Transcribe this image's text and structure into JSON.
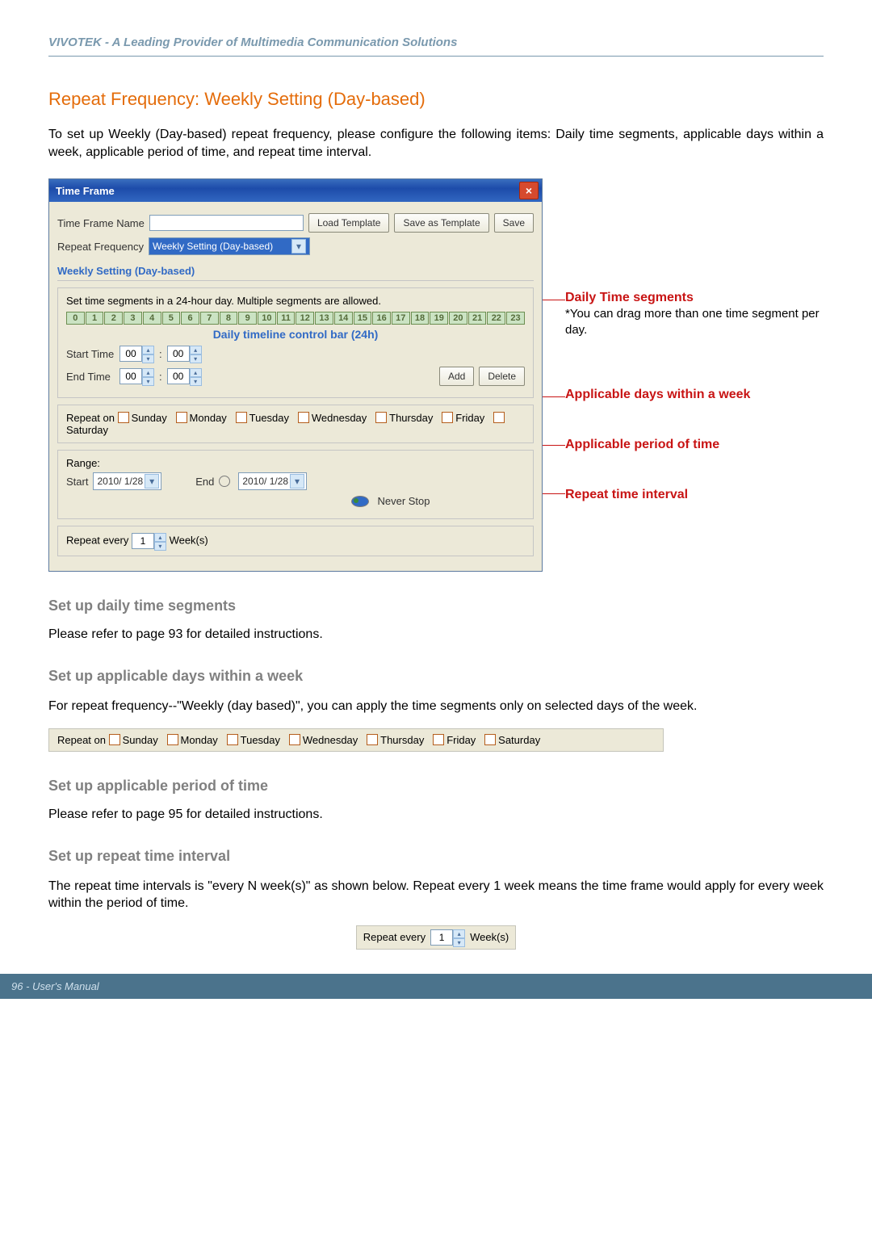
{
  "header": {
    "line": "VIVOTEK - A Leading Provider of Multimedia Communication Solutions"
  },
  "title": "Repeat Frequency: Weekly Setting (Day-based)",
  "intro": "To set up Weekly (Day-based) repeat frequency, please configure the following items: Daily time segments, applicable days within a week, applicable period of time, and repeat time interval.",
  "dlg": {
    "title": "Time Frame",
    "tfn_label": "Time Frame Name",
    "load_tpl": "Load Template",
    "save_tpl": "Save as Template",
    "save": "Save",
    "rf_label": "Repeat Frequency",
    "rf_value": "Weekly Setting (Day-based)",
    "section_hdr": "Weekly Setting (Day-based)",
    "panel1": {
      "help": "Set time segments in a 24-hour day. Multiple segments are allowed.",
      "caption": "Daily timeline control bar (24h)",
      "start_label": "Start Time",
      "end_label": "End Time",
      "start_h": "00",
      "start_m": "00",
      "end_h": "00",
      "end_m": "00",
      "add": "Add",
      "del": "Delete"
    },
    "repeat_on": "Repeat on ",
    "days": [
      "Sunday",
      "Monday",
      "Tuesday",
      "Wednesday",
      "Thursday",
      "Friday",
      "Saturday"
    ],
    "range": {
      "head": "Range:",
      "start_l": "Start",
      "start_v": "2010/ 1/28",
      "end_l": "End",
      "end_v": "2010/ 1/28",
      "never": "Never Stop"
    },
    "interval": {
      "label": "Repeat every ",
      "val": "1",
      "unit": " Week(s)"
    }
  },
  "annot": {
    "daily": {
      "title": "Daily Time segments",
      "sub": "*You can drag more than one time segment per day."
    },
    "days": "Applicable days within a week",
    "period": "Applicable period of time",
    "interval": "Repeat time interval"
  },
  "sections": {
    "daily": {
      "head": "Set up daily time segments",
      "body": "Please refer to page 93 for detailed instructions."
    },
    "days": {
      "head": "Set up applicable days within a week",
      "body": "For repeat frequency--\"Weekly (day based)\", you can apply the time segments only on selected days of the week."
    },
    "period": {
      "head": "Set up applicable period of time",
      "body": "Please refer to page 95 for detailed instructions."
    },
    "interval": {
      "head": "Set up repeat time interval",
      "body": "The repeat time intervals is \"every N week(s)\" as shown below. Repeat every 1 week means the time frame would apply for every week within the period of time."
    }
  },
  "footer": "96 - User's Manual"
}
